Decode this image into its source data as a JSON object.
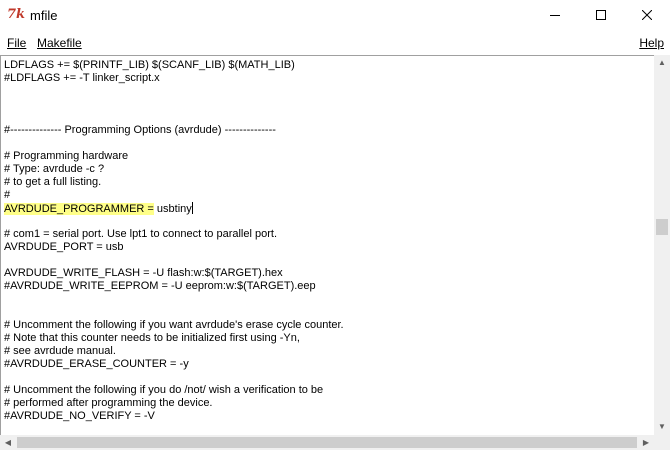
{
  "window": {
    "title": "mfile",
    "app_icon": "7k",
    "minimize_icon": "minimize-icon",
    "maximize_icon": "maximize-icon",
    "close_icon": "close-icon"
  },
  "menu": {
    "file": "File",
    "makefile": "Makefile",
    "help": "Help"
  },
  "editor": {
    "lines": [
      "LDFLAGS += $(PRINTF_LIB) $(SCANF_LIB) $(MATH_LIB)",
      "#LDFLAGS += -T linker_script.x",
      "",
      "",
      "",
      "#-------------- Programming Options (avrdude) --------------",
      "",
      "# Programming hardware",
      "# Type: avrdude -c ?",
      "# to get a full listing.",
      "#",
      "",
      "",
      "# com1 = serial port. Use lpt1 to connect to parallel port.",
      "AVRDUDE_PORT = usb",
      "",
      "AVRDUDE_WRITE_FLASH = -U flash:w:$(TARGET).hex",
      "#AVRDUDE_WRITE_EEPROM = -U eeprom:w:$(TARGET).eep",
      "",
      "",
      "# Uncomment the following if you want avrdude's erase cycle counter.",
      "# Note that this counter needs to be initialized first using -Yn,",
      "# see avrdude manual.",
      "#AVRDUDE_ERASE_COUNTER = -y",
      "",
      "# Uncomment the following if you do /not/ wish a verification to be",
      "# performed after programming the device.",
      "#AVRDUDE_NO_VERIFY = -V"
    ],
    "highlighted_line": {
      "highlight_text": "AVRDUDE_PROGRAMMER =",
      "rest_text": " usbtiny",
      "highlight_color": "#ffff88"
    }
  },
  "scrollbars": {
    "vertical_position": 0.43,
    "horizontal_position": 0.0
  }
}
